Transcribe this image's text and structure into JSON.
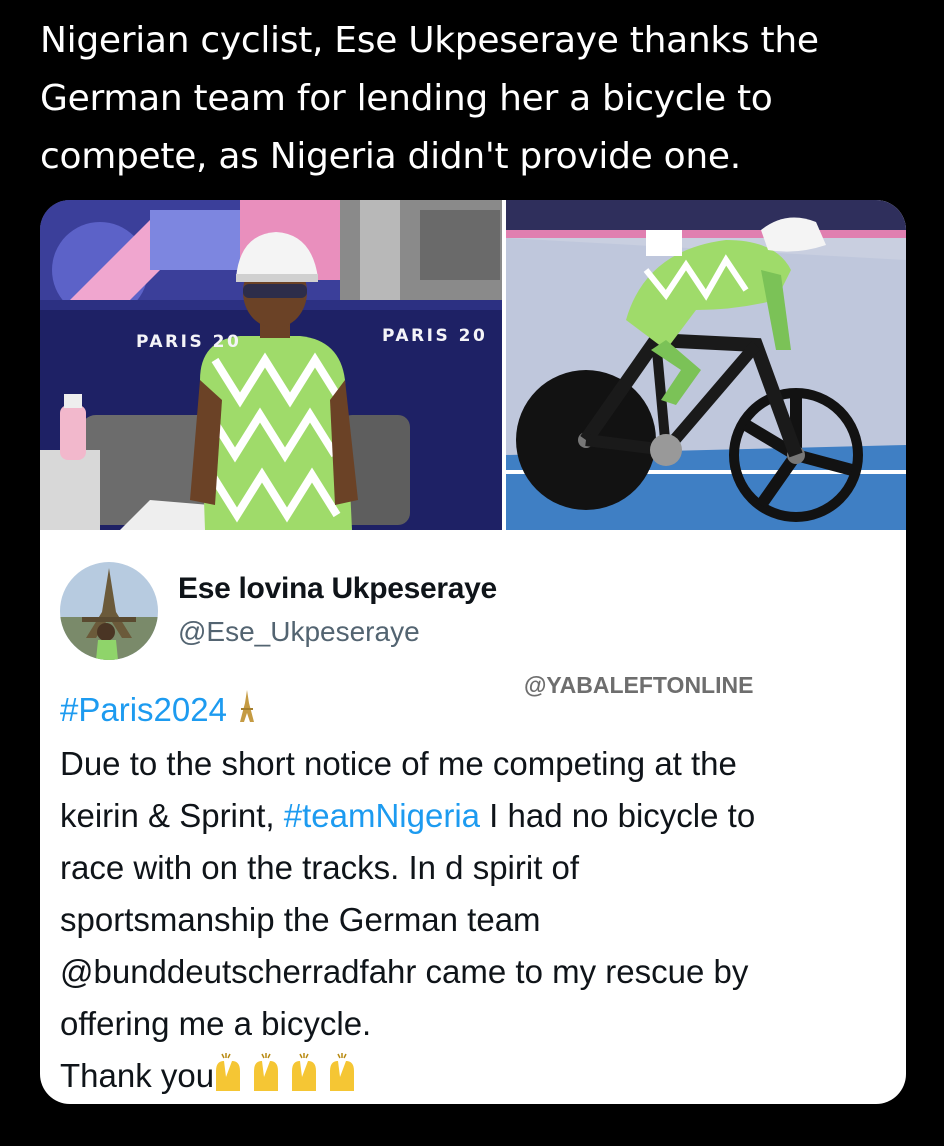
{
  "headline": {
    "line1": "Nigerian cyclist, Ese Ukpeseraye thanks the",
    "line2": "German team for lending her a bicycle to",
    "line3": "compete, as Nigeria didn't provide one."
  },
  "photos": {
    "board_text_1": "PARIS 20",
    "board_text_2": "PARIS 20"
  },
  "profile": {
    "display_name": "Ese lovina Ukpeseraye",
    "handle": "@Ese_Ukpeseraye"
  },
  "watermark": "@YABALEFTONLINE",
  "tweet": {
    "hashtag_paris": "#Paris2024",
    "line1": "Due to the short notice of me competing at the",
    "line2_pre": "keirin & Sprint, ",
    "hashtag_team": "#teamNigeria",
    "line2_post": " I had no bicycle to",
    "line3": "race with on the tracks. In d spirit of",
    "line4": "sportsmanship the German team",
    "line5": "@bunddeutscherradfahr came to my rescue by",
    "line6": "offering me a bicycle.",
    "line7": "Thank you"
  },
  "icons": {
    "eiffel": "eiffel-tower-icon",
    "praise": "raised-hands-icon"
  },
  "colors": {
    "background": "#000000",
    "card": "#ffffff",
    "link": "#1d9bf0",
    "text": "#0f1419",
    "secondary": "#536471"
  }
}
